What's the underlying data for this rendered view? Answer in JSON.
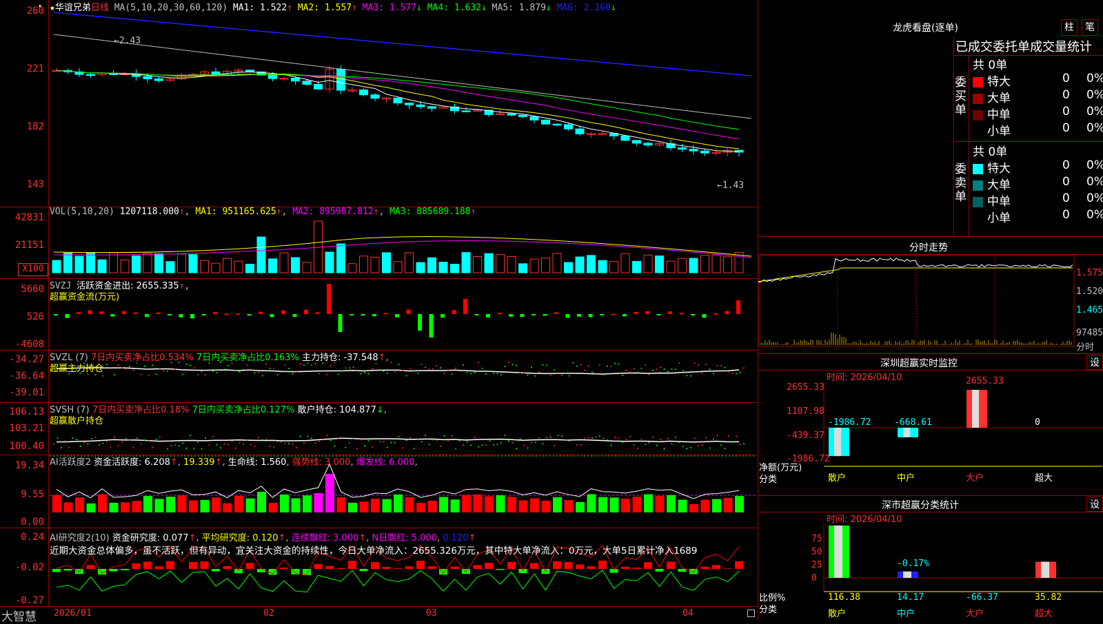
{
  "stock": {
    "star": "★",
    "name": "华谊兄弟",
    "period": "日线",
    "ma_label": "MA(5,10,20,30,60,120)",
    "ma": [
      {
        "n": "MA1",
        "v": "1.522",
        "a": "↑",
        "c": "#ffffff"
      },
      {
        "n": "MA2",
        "v": "1.557",
        "a": "↑",
        "c": "#ffff00"
      },
      {
        "n": "MA3",
        "v": "1.577",
        "a": "↓",
        "c": "#ff00ff"
      },
      {
        "n": "MA4",
        "v": "1.632",
        "a": "↓",
        "c": "#00ff00"
      },
      {
        "n": "MA5",
        "v": "1.879",
        "a": "↓",
        "c": "#c0c0c0"
      },
      {
        "n": "MA6",
        "v": "2.160",
        "a": "↓",
        "c": "#2020ff"
      }
    ],
    "yticks": [
      "260",
      "221",
      "182",
      "143"
    ],
    "high_ann": "←2.43",
    "low_ann": "←1.43",
    "icon": "settings-icon"
  },
  "vol": {
    "label": "VOL(5,10,20)",
    "value": "1207118.000",
    "ma1": "MA1: 951165.625",
    "ma2": "MA2: 895987.812",
    "ma3": "MA3: 885689.188",
    "yticks": [
      "42831",
      "21151"
    ],
    "unit": "X100"
  },
  "svzj": {
    "label": "SVZJ",
    "text": "活跃资金进出: 2655.335",
    "sub": "超赢资金流(万元)",
    "yticks": [
      "5660",
      "526",
      "-4608"
    ]
  },
  "svzl": {
    "label": "SVZL (7)",
    "t1": "7日内买卖净占比0.534%",
    "t2": "7日内买卖净占比0.163%",
    "t3": "主力持仓: -37.548",
    "sub": "超赢主力持仓",
    "yticks": [
      "-34.27",
      "-36.64",
      "-39.01"
    ]
  },
  "svsh": {
    "label": "SVSH (7)",
    "t1": "7日内买卖净占比0.18%",
    "t2": "7日内买卖净占比0.127%",
    "t3": "散户持仓: 104.877",
    "sub": "超赢散户持仓",
    "yticks": [
      "106.13",
      "103.21",
      "100.40"
    ]
  },
  "ai1": {
    "label": "AI活跃度2",
    "t1": "资金活跃度: 6.208",
    "t2": "19.339",
    "t3": "生命线: 1.560",
    "t4": "强势线: 3.000",
    "t5": "爆发线: 6.000",
    "yticks": [
      "19.34",
      "9.55",
      "0.00"
    ]
  },
  "ai2": {
    "label": "AI研究度2(10)",
    "t1": "资金研究度: 0.077",
    "t2": "平均研究度: 0.120",
    "t3": "连续飘红: 3.000",
    "t4": "N日飘红: 5.000",
    "t5": "0.120",
    "comment": "近期大资金总体偏多，虽不活跃，但有异动，宜关注大资金的持续性，今日大单净流入：2655.326万元，其中特大单净流入：0万元，大单5日累计净入1689",
    "yticks": [
      "0.24",
      "-0.02",
      "-0.27"
    ]
  },
  "xaxis": [
    "2026/01",
    "02",
    "03",
    "04"
  ],
  "brand": "大智慧",
  "dragon": {
    "title": "龙虎看盘(逐单)",
    "btn1": "柱",
    "btn2": "笔",
    "tabs": "已成交委托单成交量统计",
    "buy_side": "委买单",
    "sell_side": "委卖单",
    "buy_total": "共 0单",
    "sell_total": "共 0单",
    "buy": [
      {
        "name": "特大",
        "val": "0",
        "pct": "0%",
        "color": "#ff0000"
      },
      {
        "name": "大单",
        "val": "0",
        "pct": "0%",
        "color": "#a00000"
      },
      {
        "name": "中单",
        "val": "0",
        "pct": "0%",
        "color": "#700000"
      },
      {
        "name": "小单",
        "val": "0",
        "pct": "0%",
        "color": ""
      }
    ],
    "sell": [
      {
        "name": "特大",
        "val": "0",
        "pct": "0%",
        "color": "#00ffff"
      },
      {
        "name": "大单",
        "val": "0",
        "pct": "0%",
        "color": "#008080"
      },
      {
        "name": "中单",
        "val": "0",
        "pct": "0%",
        "color": "#006060"
      },
      {
        "name": "小单",
        "val": "0",
        "pct": "0%",
        "color": ""
      }
    ]
  },
  "intraday": {
    "title": "分时走势",
    "prices": [
      "1.575",
      "1.520",
      "1.465"
    ],
    "vol": "97485",
    "label": "分时"
  },
  "monitor": {
    "title": "深圳超赢实时监控",
    "set": "设",
    "time": "时间: 2026/04/10",
    "yticks": [
      "2655.33",
      "1107.98",
      "-439.37",
      "-1986.72"
    ],
    "ylabel": "净额(万元)",
    "xlabel": "分类",
    "cats": [
      "散户",
      "中户",
      "大户",
      "超大"
    ],
    "values": [
      -1986.72,
      -668.61,
      2655.33,
      0
    ],
    "value_labels": [
      "-1986.72",
      "-668.61",
      "2655.33",
      "0"
    ]
  },
  "stats": {
    "title": "深市超赢分类统计",
    "set": "设",
    "time": "时间: 2026/04/10",
    "yticks": [
      "75",
      "50",
      "25",
      "0"
    ],
    "ylabel": "比例%",
    "xlabel": "分类",
    "cats": [
      "散户",
      "中户",
      "大户",
      "超大"
    ],
    "values": [
      116.38,
      14.17,
      -66.37,
      35.82
    ],
    "value_labels": [
      "116.38",
      "14.17",
      "-66.37",
      "35.82"
    ],
    "ann": "-0.17%"
  }
}
